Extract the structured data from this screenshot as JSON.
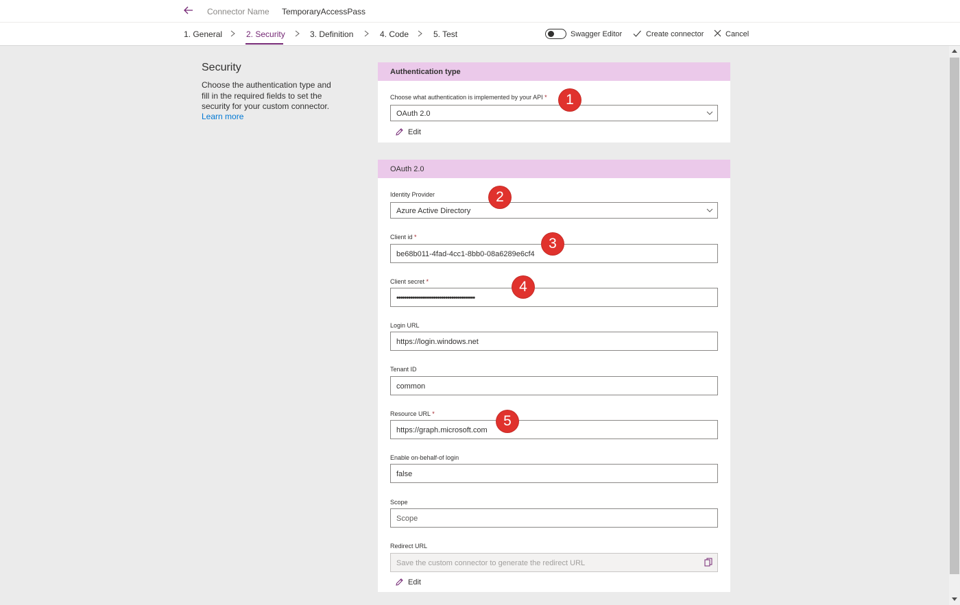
{
  "header": {
    "connector_name_label": "Connector Name",
    "connector_name_value": "TemporaryAccessPass"
  },
  "steps": [
    {
      "label": "1. General"
    },
    {
      "label": "2. Security"
    },
    {
      "label": "3. Definition"
    },
    {
      "label": "4. Code"
    },
    {
      "label": "5. Test"
    }
  ],
  "toolbar": {
    "swagger_label": "Swagger Editor",
    "create_label": "Create connector",
    "cancel_label": "Cancel"
  },
  "intro": {
    "title": "Security",
    "description": "Choose the authentication type and fill in the required fields to set the security for your custom connector.",
    "learn_more": "Learn more"
  },
  "auth_card": {
    "header": "Authentication type",
    "field_label": "Choose what authentication is implemented by your API",
    "required_mark": "*",
    "value": "OAuth 2.0",
    "edit_label": "Edit"
  },
  "oauth_card": {
    "header": "OAuth 2.0",
    "identity_provider": {
      "label": "Identity Provider",
      "value": "Azure Active Directory"
    },
    "client_id": {
      "label": "Client id",
      "required": "*",
      "value": "be68b011-4fad-4cc1-8bb0-08a6289e6cf4"
    },
    "client_secret": {
      "label": "Client secret",
      "required": "*",
      "value": "••••••••••••••••••••••••••••••••••••••••"
    },
    "login_url": {
      "label": "Login URL",
      "value": "https://login.windows.net"
    },
    "tenant_id": {
      "label": "Tenant ID",
      "value": "common"
    },
    "resource_url": {
      "label": "Resource URL",
      "required": "*",
      "value": "https://graph.microsoft.com"
    },
    "on_behalf_of": {
      "label": "Enable on-behalf-of login",
      "value": "false"
    },
    "scope": {
      "label": "Scope",
      "placeholder": "Scope"
    },
    "redirect_url": {
      "label": "Redirect URL",
      "placeholder": "Save the custom connector to generate the redirect URL"
    },
    "edit_label": "Edit"
  },
  "badges": [
    "1",
    "2",
    "3",
    "4",
    "5"
  ],
  "colors": {
    "accent": "#742774",
    "card_header": "#ebc9ea",
    "link": "#0078d4",
    "badge": "#e0322d",
    "page_bg": "#ebebeb"
  }
}
